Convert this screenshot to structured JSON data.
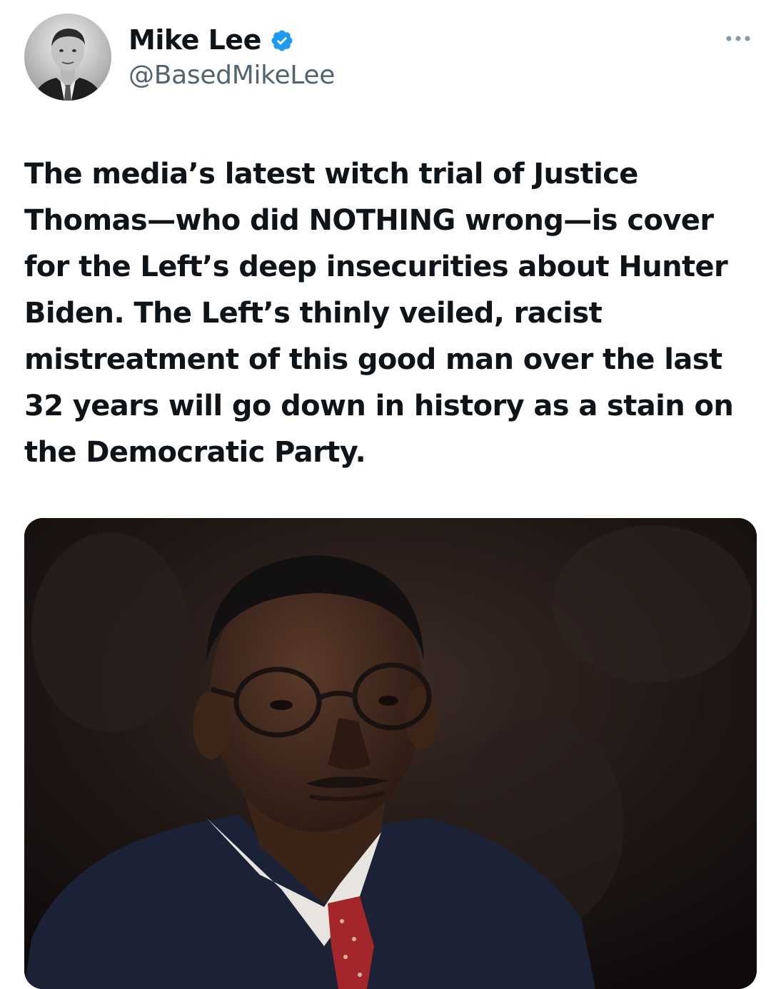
{
  "author": {
    "display_name": "Mike Lee",
    "handle": "@BasedMikeLee",
    "verified": true,
    "avatar_icon": "profile-photo",
    "verified_icon": "verified-badge-icon",
    "verified_color": "#1d9bf0"
  },
  "menu": {
    "icon": "more-horizontal-icon"
  },
  "tweet": {
    "text": "The media’s latest witch trial of Justice\nThomas—who did NOTHING wrong—is cover\nfor the Left’s deep insecurities about Hunter\nBiden. The Left’s thinly veiled, racist\nmistreatment of this good man over the last\n32 years will go down in history as a stain on\nthe Democratic Party."
  },
  "media": {
    "type": "photo",
    "icon": "portrait-photo"
  },
  "colors": {
    "text": "#0f1419",
    "secondary_text": "#536471",
    "background": "#ffffff"
  }
}
